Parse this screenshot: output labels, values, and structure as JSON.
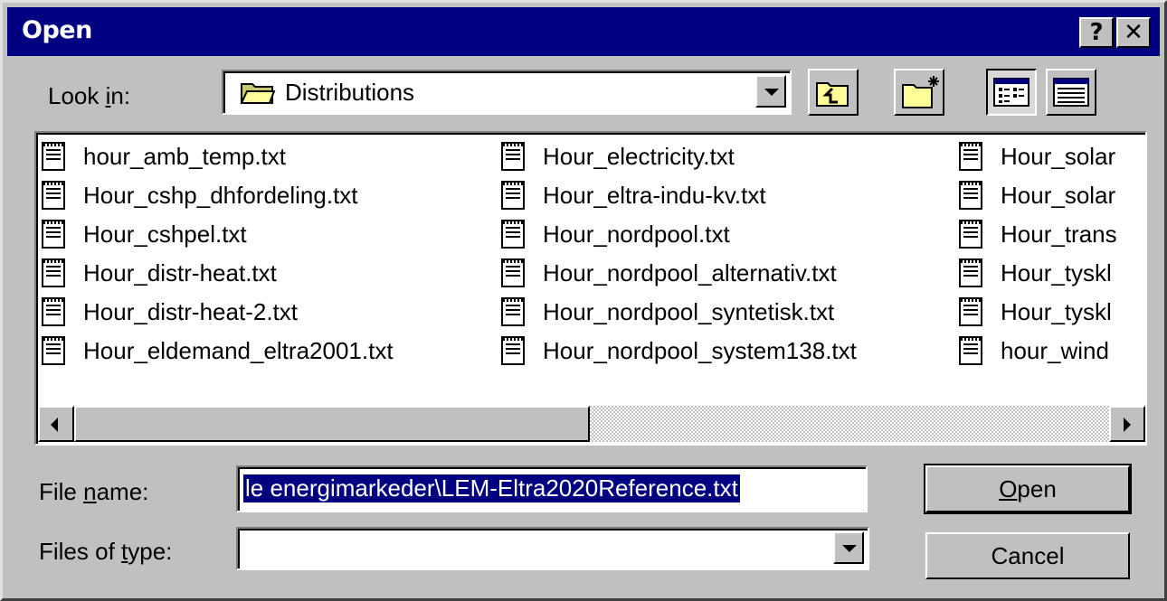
{
  "window": {
    "title": "Open",
    "help_label": "?",
    "close_label": "✕"
  },
  "look_in": {
    "label_pre": "Look ",
    "label_key": "i",
    "label_post": "n:",
    "value": "Distributions"
  },
  "toolbar": {
    "up_icon": "up-one-level-icon",
    "new_folder_icon": "create-new-folder-icon",
    "list_icon": "list-view-icon",
    "details_icon": "details-view-icon"
  },
  "files": {
    "col1": [
      "hour_amb_temp.txt",
      "Hour_cshp_dhfordeling.txt",
      "Hour_cshpel.txt",
      "Hour_distr-heat.txt",
      "Hour_distr-heat-2.txt",
      "Hour_eldemand_eltra2001.txt"
    ],
    "col2": [
      "Hour_electricity.txt",
      "Hour_eltra-indu-kv.txt",
      "Hour_nordpool.txt",
      "Hour_nordpool_alternativ.txt",
      "Hour_nordpool_syntetisk.txt",
      "Hour_nordpool_system138.txt"
    ],
    "col3": [
      "Hour_solar",
      "Hour_solar",
      "Hour_trans",
      "Hour_tyskl",
      "Hour_tyskl",
      "hour_wind"
    ]
  },
  "file_name": {
    "label_pre": "File ",
    "label_key": "n",
    "label_post": "ame:",
    "value": "le energimarkeder\\LEM-Eltra2020Reference.txt"
  },
  "file_type": {
    "label_pre": "Files of ",
    "label_key": "t",
    "label_post": "ype:",
    "value": ""
  },
  "buttons": {
    "open_key": "O",
    "open_rest": "pen",
    "cancel": "Cancel"
  },
  "colors": {
    "titlebar": "#000080",
    "face": "#c0c0c0",
    "selection": "#000080"
  }
}
